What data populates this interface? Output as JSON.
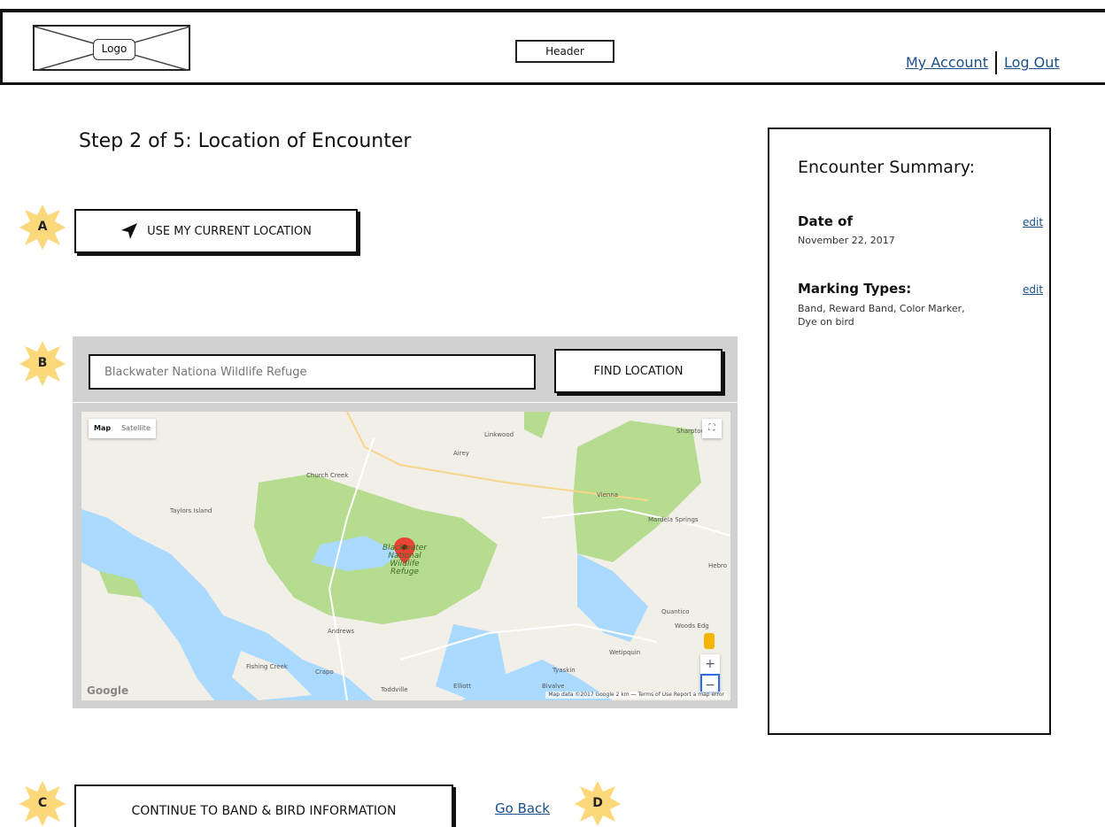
{
  "header": {
    "logo_text": "Logo",
    "header_text": "Header",
    "my_account": "My Account",
    "log_out": "Log Out"
  },
  "main": {
    "step_title": "Step 2 of 5: Location of Encounter",
    "use_location_label": "USE MY CURRENT LOCATION",
    "search": {
      "value": "",
      "placeholder": "Blackwater Nationa Wildlife Refuge"
    },
    "find_location_label": "FIND LOCATION",
    "continue_label": "CONTINUE TO BAND & BIRD INFORMATION",
    "go_back_label": "Go Back"
  },
  "annotations": {
    "a": "A",
    "b": "B",
    "c": "C",
    "d": "D"
  },
  "map": {
    "map_tab": "Map",
    "satellite_tab": "Satellite",
    "google": "Google",
    "attribution": "Map data ©2017 Google   2 km ⎯⎯   Terms of Use   Report a map error",
    "places": {
      "linkwood": "Linkwood",
      "sharptown": "Sharptown",
      "airey": "Airey",
      "church_creek": "Church Creek",
      "taylors_island": "Taylors Island",
      "vienna": "Vienna",
      "mardela_springs": "Mardela Springs",
      "refuge_1": "Blackwater",
      "refuge_2": "National",
      "refuge_3": "Wildlife",
      "refuge_4": "Refuge",
      "hebron": "Hebro",
      "quantico": "Quantico",
      "woods_edge": "Woods Edg",
      "andrews": "Andrews",
      "wetipquin": "Wetipquin",
      "fishing_creek": "Fishing Creek",
      "crapo": "Crapo",
      "tyaskin": "Tyaskin",
      "toddville": "Toddville",
      "elliott": "Elliott",
      "bivalve": "Bivalve"
    }
  },
  "summary": {
    "title": "Encounter Summary:",
    "date_heading": "Date of",
    "date_value": "November 22, 2017",
    "marking_heading": "Marking Types:",
    "marking_value": "Band, Reward Band, Color Marker, Dye on bird",
    "edit_label": "edit"
  },
  "colors": {
    "link": "#1a4f8c",
    "star": "#fbd97a",
    "water": "#aadaff",
    "land": "#f2efe9",
    "park": "#b6dc8f"
  }
}
